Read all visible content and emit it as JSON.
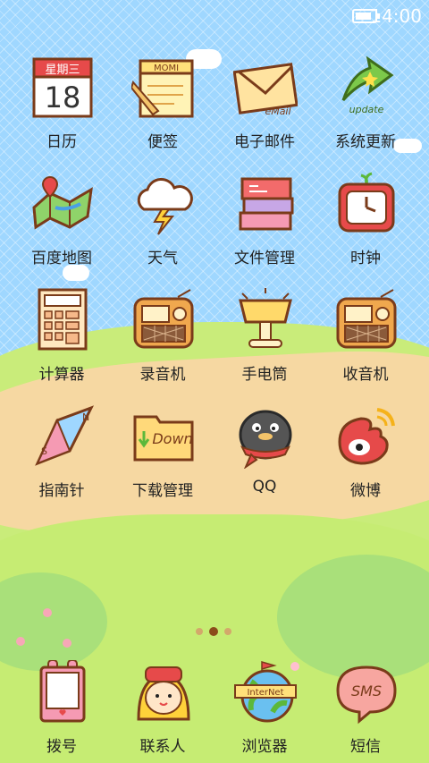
{
  "status_bar": {
    "time": "14:00",
    "battery_level": 0.85
  },
  "apps": [
    {
      "label": "日历",
      "icon": "calendar-icon",
      "calendar": {
        "weekday": "星期三",
        "day": "18"
      }
    },
    {
      "label": "便签",
      "icon": "notes-icon",
      "note_tag": "MOMI"
    },
    {
      "label": "电子邮件",
      "icon": "mail-icon",
      "mail_tag": "eMail"
    },
    {
      "label": "系统更新",
      "icon": "update-icon",
      "update_tag": "update"
    },
    {
      "label": "百度地图",
      "icon": "map-icon"
    },
    {
      "label": "天气",
      "icon": "weather-icon"
    },
    {
      "label": "文件管理",
      "icon": "files-icon"
    },
    {
      "label": "时钟",
      "icon": "clock-icon"
    },
    {
      "label": "计算器",
      "icon": "calculator-icon"
    },
    {
      "label": "录音机",
      "icon": "recorder-icon"
    },
    {
      "label": "手电筒",
      "icon": "flashlight-icon"
    },
    {
      "label": "收音机",
      "icon": "radio-icon"
    },
    {
      "label": "指南针",
      "icon": "compass-icon",
      "compass_letters": [
        "N",
        "S"
      ]
    },
    {
      "label": "下载管理",
      "icon": "download-icon",
      "download_tag": "Down"
    },
    {
      "label": "QQ",
      "icon": "qq-icon"
    },
    {
      "label": "微博",
      "icon": "weibo-icon"
    }
  ],
  "dock": [
    {
      "label": "拨号",
      "icon": "phone-icon"
    },
    {
      "label": "联系人",
      "icon": "contacts-icon"
    },
    {
      "label": "浏览器",
      "icon": "browser-icon",
      "browser_tag": "InterNet"
    },
    {
      "label": "短信",
      "icon": "sms-icon",
      "sms_tag": "SMS"
    }
  ],
  "page_indicator": {
    "pages": 3,
    "current": 2
  }
}
